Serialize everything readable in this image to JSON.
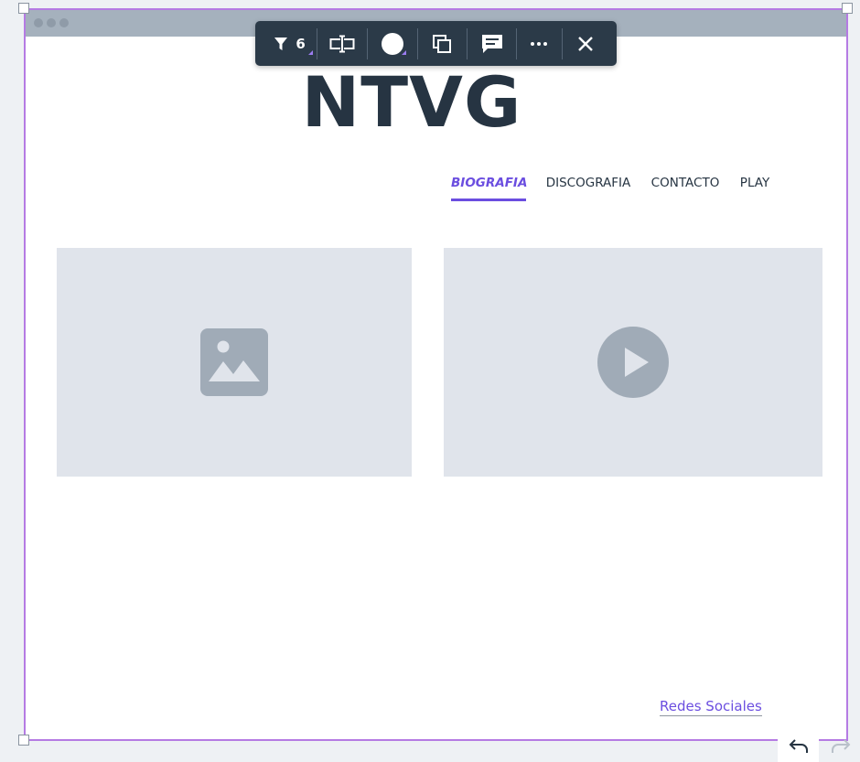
{
  "colors": {
    "selection": "#b57be3",
    "accent": "#6b4ee0",
    "toolbar_bg": "#2b3a48",
    "placeholder_bg": "#e0e4eb",
    "placeholder_icon": "#a0abb7",
    "text_dark": "#263442"
  },
  "toolbar": {
    "filter_icon": "filter-icon",
    "filter_count": "6",
    "tools": [
      "filter-icon",
      "text-field-icon",
      "color-circle-icon",
      "duplicate-icon",
      "comment-icon",
      "more-icon",
      "close-icon"
    ]
  },
  "page": {
    "title": "NTVG",
    "nav": [
      {
        "label": "BIOGRAFIA",
        "active": true
      },
      {
        "label": "DISCOGRAFIA",
        "active": false
      },
      {
        "label": "CONTACTO",
        "active": false
      },
      {
        "label": "PLAY",
        "active": false
      }
    ],
    "image_placeholder_icon": "image-icon",
    "video_placeholder_icon": "play-icon",
    "footer_link": "Redes Sociales"
  },
  "history": {
    "undo_icon": "undo-icon",
    "redo_icon": "redo-icon"
  }
}
